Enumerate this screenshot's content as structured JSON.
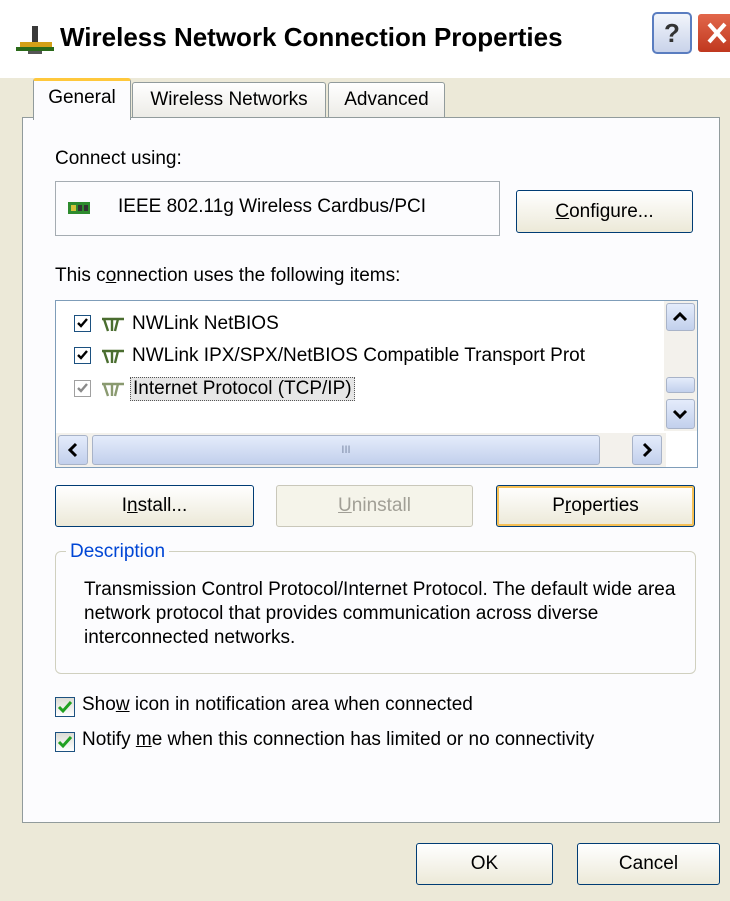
{
  "window": {
    "title": "Wireless Network Connection Properties",
    "help": "?"
  },
  "tabs": [
    {
      "label": "General",
      "active": true
    },
    {
      "label": "Wireless Networks",
      "active": false
    },
    {
      "label": "Advanced",
      "active": false
    }
  ],
  "connect_using": {
    "label": "Connect using:",
    "adapter": "IEEE 802.11g Wireless Cardbus/PCI",
    "configure_button": {
      "pre": "",
      "mnemonic": "C",
      "post": "onfigure..."
    }
  },
  "items_label": {
    "pre": "This c",
    "mnemonic": "o",
    "post": "nnection uses the following items:"
  },
  "items": [
    {
      "label": "NWLink NetBIOS",
      "checked": true
    },
    {
      "label": "NWLink IPX/SPX/NetBIOS Compatible Transport Prot",
      "checked": true
    },
    {
      "label": "Internet Protocol (TCP/IP)",
      "checked": true,
      "selected": true
    }
  ],
  "scroll": {
    "grip": "III"
  },
  "buttons": {
    "install": {
      "pre": "I",
      "mnemonic": "n",
      "post": "stall..."
    },
    "uninstall": {
      "pre": "",
      "mnemonic": "U",
      "post": "ninstall"
    },
    "properties": {
      "pre": "P",
      "mnemonic": "r",
      "post": "operties"
    },
    "ok": "OK",
    "cancel": "Cancel"
  },
  "description": {
    "legend": "Description",
    "text": "Transmission Control Protocol/Internet Protocol. The default wide area network protocol that provides communication across diverse interconnected networks."
  },
  "options": [
    {
      "pre": "Sho",
      "mnemonic": "w",
      "post": " icon in notification area when connected",
      "checked": true
    },
    {
      "pre": "Notify ",
      "mnemonic": "m",
      "post": "e when this connection has limited or no connectivity",
      "checked": true
    }
  ],
  "colors": {
    "accent_focus": "#f6c055",
    "legend": "#0046d5",
    "check": "#21a121"
  }
}
